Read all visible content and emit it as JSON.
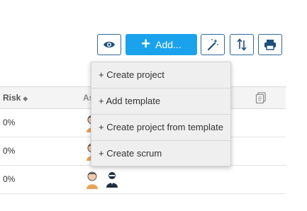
{
  "toolbar": {
    "view_icon": "eye-icon",
    "add_label": "Add...",
    "magic_icon": "magic-wand-icon",
    "sort_icon": "sort-arrows-icon",
    "print_icon": "printer-icon",
    "accent_color": "#1aa3ec",
    "border_color": "#2f6796"
  },
  "add_menu": {
    "items": [
      {
        "label": "+ Create project"
      },
      {
        "label": "+ Add template"
      },
      {
        "label": "+ Create project from template"
      },
      {
        "label": "+ Create scrum"
      }
    ]
  },
  "grid": {
    "columns": {
      "risk": "Risk",
      "assignee": "As",
      "notes_icon": "notes-icon"
    },
    "rows": [
      {
        "risk": "0%"
      },
      {
        "risk": "0%"
      },
      {
        "risk": "0%"
      }
    ]
  }
}
